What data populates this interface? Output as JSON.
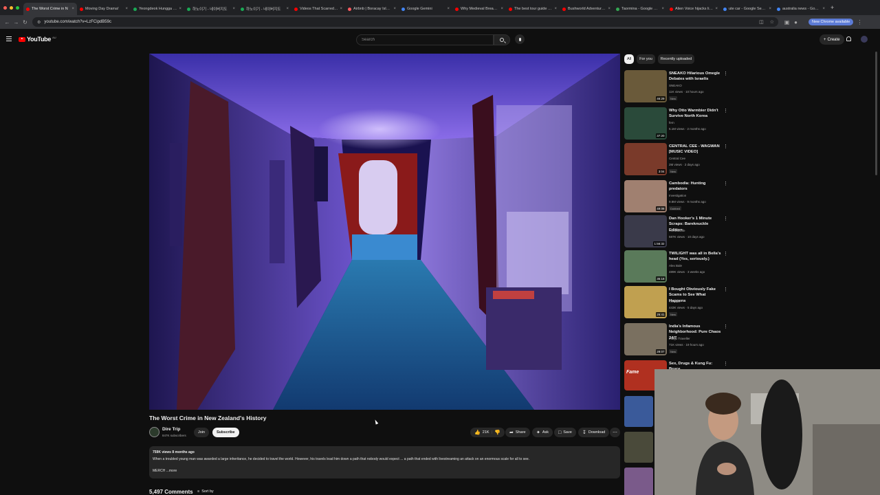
{
  "browser": {
    "tabs": [
      {
        "label": "The Worst Crime in N",
        "active": true,
        "color": "#ff0000"
      },
      {
        "label": "Moving Day Drama!",
        "active": false,
        "color": "#ff0000"
      },
      {
        "label": "Yeongdeok Hungga - Nav",
        "active": false,
        "color": "#1aaa55"
      },
      {
        "label": "하노이기 - 네이버지도",
        "active": false,
        "color": "#1aaa55"
      },
      {
        "label": "하노이기 - 네이버지도",
        "active": false,
        "color": "#1aaa55"
      },
      {
        "label": "Videos That Scarred Aus",
        "active": false,
        "color": "#ff0000"
      },
      {
        "label": "Airbnb | Boracay Island",
        "active": false,
        "color": "#ff5a5f"
      },
      {
        "label": "Google Gemini",
        "active": false,
        "color": "#4285f4"
      },
      {
        "label": "Why Medieval Bread Was",
        "active": false,
        "color": "#ff0000"
      },
      {
        "label": "The best tour guide #pl",
        "active": false,
        "color": "#ff0000"
      },
      {
        "label": "Bushworld Adventures |",
        "active": false,
        "color": "#ff0000"
      },
      {
        "label": "Taormina - Google Sear",
        "active": false,
        "color": "#34a853"
      },
      {
        "label": "Alien Voice hijacks live T",
        "active": false,
        "color": "#ff0000"
      },
      {
        "label": "ute car - Google Search",
        "active": false,
        "color": "#4285f4"
      },
      {
        "label": "australia news - Google",
        "active": false,
        "color": "#4285f4"
      }
    ],
    "new_tab": "+",
    "url": "youtube.com/watch?v=LzFCipdB59c",
    "new_chrome_label": "New Chrome available"
  },
  "header": {
    "logo_text": "YouTube",
    "logo_country": "AU",
    "search_placeholder": "Search",
    "create_label": "Create"
  },
  "video": {
    "title": "The Worst Crime in New Zealand's History",
    "channel": "Dire Trip",
    "subscribers": "847K subscribers",
    "join_label": "Join",
    "subscribe_label": "Subscribe",
    "likes": "21K",
    "share_label": "Share",
    "ask_label": "Ask",
    "save_label": "Save",
    "download_label": "Download",
    "views_date": "759K views  8 months ago",
    "description": "When a troubled young man was awarded a large inheritance, he decided to travel the world. However, his travels lead him down a path that nobody would expect ... a path that ended with livestreaming an attack on an enormous scale for all to see.",
    "more": "MERCH ...more",
    "comments_count": "5,497 Comments",
    "sort_label": "Sort by"
  },
  "sidebar": {
    "chips": [
      "All",
      "For you",
      "Recently uploaded"
    ],
    "recommendations": [
      {
        "title": "SNEAKO Hilarious Omegle Debates with Israelis",
        "channel": "SNEAKO",
        "meta": "11K views · 10 hours ago",
        "badge": "New",
        "duration": "46:29",
        "thumb": "#6a5a3a"
      },
      {
        "title": "Why Otto Warmbier Didn't Survive North Korea",
        "channel": "fern",
        "meta": "5.1M views · 2 months ago",
        "badge": "",
        "duration": "37:20",
        "thumb": "#2a4a3a"
      },
      {
        "title": "CENTRAL CEE - WAGWAN [MUSIC VIDEO]",
        "channel": "Central Cee",
        "meta": "2M views · 2 days ago",
        "badge": "New",
        "duration": "3:04",
        "thumb": "#7a3a2a"
      },
      {
        "title": "Cambodia: Hunting predators",
        "channel": "Investigation",
        "meta": "9.8M views · 9 months ago",
        "badge": "Dubbed",
        "duration": "49:08",
        "thumb": "#a08070"
      },
      {
        "title": "Dan Hooker's 1 Minute Scraps: Bareknuckle Edition",
        "channel": "TheMacLife",
        "meta": "587K views · 10 days ago",
        "badge": "",
        "duration": "1:56:32",
        "thumb": "#3a3a4a"
      },
      {
        "title": "TWILIGHT was all in Bella's head (Yes, seriously.)",
        "channel": "Alex Bale",
        "meta": "489K views · 3 weeks ago",
        "badge": "",
        "duration": "35:18",
        "thumb": "#5a7a5a"
      },
      {
        "title": "I Bought Obviously Fake Scams to See What Happens",
        "channel": "Trenium",
        "meta": "443K views · 5 days ago",
        "badge": "New",
        "duration": "26:41",
        "thumb": "#c0a050"
      },
      {
        "title": "India's Infamous Neighborhood: Pure Chaos 24/7",
        "channel": "Indigo Traveller",
        "meta": "71K views · 19 hours ago",
        "badge": "New",
        "duration": "28:07",
        "thumb": "#7a7060"
      },
      {
        "title": "Sex, Drugs & Kung Fu: Bruce",
        "channel": "",
        "meta": "",
        "badge": "",
        "duration": "",
        "thumb": "#b03020"
      }
    ],
    "fame_label": "Fame"
  },
  "colors": {
    "background": "#0f0f0f",
    "accent": "#ff0000",
    "surface": "#272727"
  }
}
